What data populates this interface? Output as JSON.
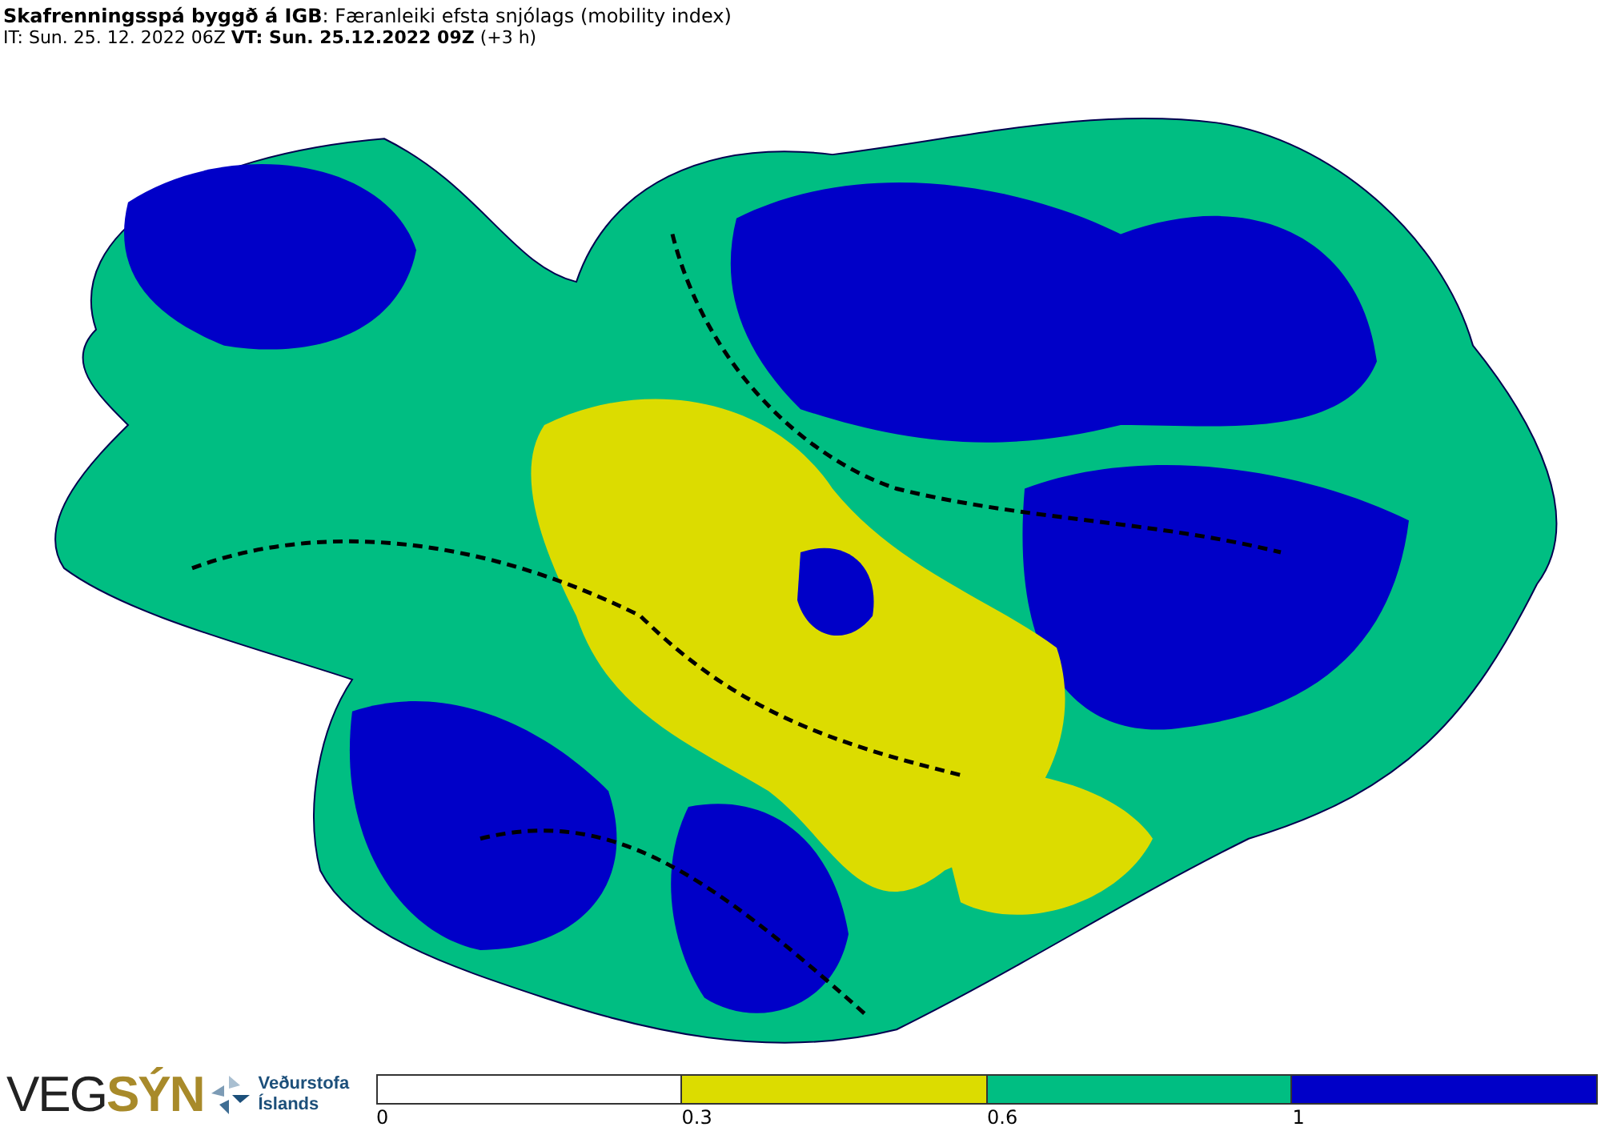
{
  "header": {
    "title": "**Skafrenningsspá byggð á IGB**: Færanleiki efsta snjólags (mobility index)",
    "subtitle": "IT: Sun. 25. 12. 2022 06Z **VT: Sun. 25.12.2022 09Z** (+3 h)"
  },
  "logos": {
    "vegsyn": [
      "VEG",
      "SÝN"
    ],
    "vedurstofa": [
      "Veðurstofa",
      "Íslands"
    ]
  },
  "legend": {
    "segments": [
      {
        "color": "#ffffff",
        "label": "0"
      },
      {
        "color": "#dcdc00",
        "label": "0.3"
      },
      {
        "color": "#00be82",
        "label": "0.6"
      },
      {
        "color": "#0000c8",
        "label": "1"
      }
    ]
  }
}
